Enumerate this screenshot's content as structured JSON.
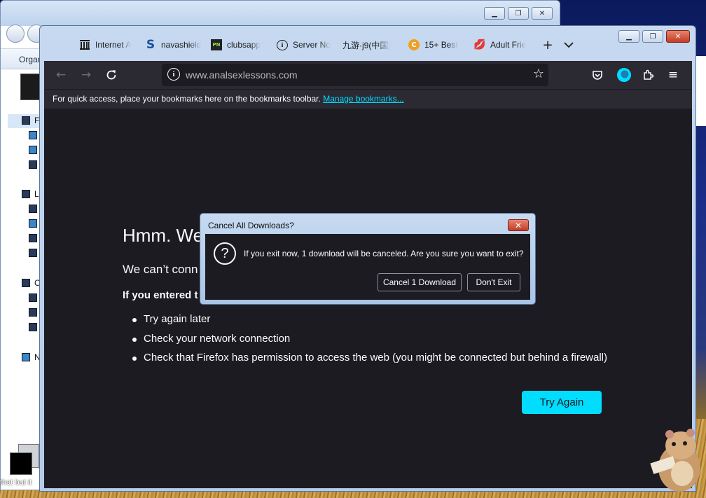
{
  "explorer": {
    "toolbar_label": "Organ",
    "tree_labels": [
      "F",
      "L",
      "C",
      "N"
    ]
  },
  "firefox": {
    "tabs": [
      {
        "label": "Internet A",
        "icon": "archive-icon"
      },
      {
        "label": "navashield",
        "icon": "s-logo-icon"
      },
      {
        "label": "clubsapp",
        "icon": "pn-logo-icon"
      },
      {
        "label": "Server No",
        "icon": "info-circle-icon"
      },
      {
        "label": "九游·j9(中国)",
        "icon": ""
      },
      {
        "label": "15+ Best",
        "icon": "c-logo-icon"
      },
      {
        "label": "Adult Frie",
        "icon": "lips-icon"
      }
    ],
    "url": "www.analsexlessons.com",
    "bookmarks_bar": {
      "text": "For quick access, place your bookmarks here on the bookmarks toolbar.",
      "link": "Manage bookmarks..."
    },
    "colors": {
      "accent": "#00ddff",
      "page_bg": "#1c1b22",
      "toolbar_bg": "#2b2a33"
    }
  },
  "error_page": {
    "title": "Hmm. We",
    "short_desc": "We can’t conn",
    "entered_prefix": "If you entered t",
    "suggestions": [
      "Try again later",
      "Check your network connection",
      "Check that Firefox has permission to access the web (you might be connected but behind a firewall)"
    ],
    "try_again": "Try Again"
  },
  "dialog": {
    "title": "Cancel All Downloads?",
    "message": "If you exit now, 1 download will be canceled. Are you sure you want to exit?",
    "cancel_button": "Cancel 1 Download",
    "dont_exit_button": "Don't Exit"
  },
  "desktop": {
    "icon_label": "that but it"
  }
}
